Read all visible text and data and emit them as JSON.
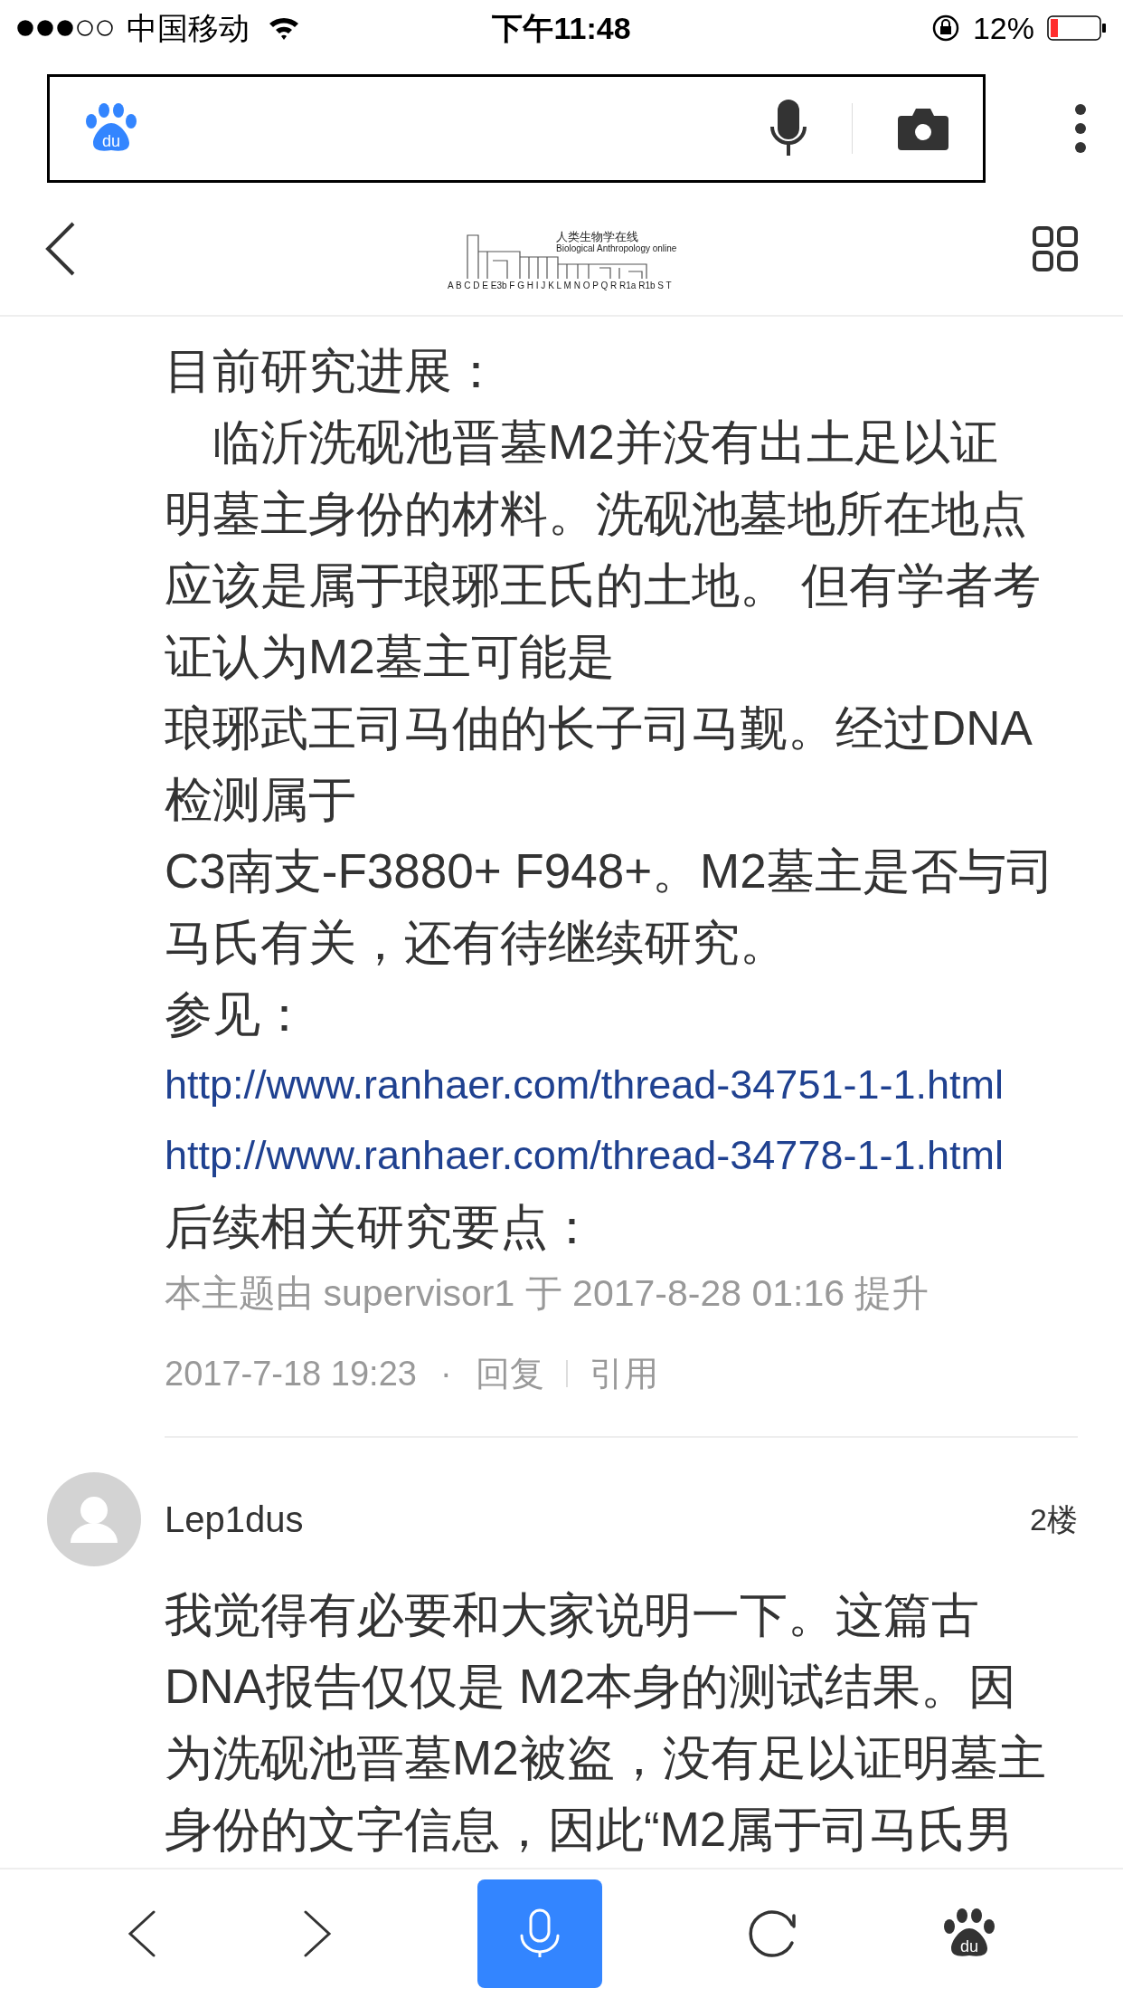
{
  "status_bar": {
    "carrier": "中国移动",
    "time": "下午11:48",
    "battery": "12%"
  },
  "search_bar": {
    "logo_text": "du"
  },
  "site_header": {
    "title": "人类生物学在线",
    "subtitle": "Biological Anthropology online",
    "letters": "A B C D E E3b F G H I J K L M N O P Q R R1a R1b S T"
  },
  "post_1": {
    "lines": [
      {
        "kind": "text",
        "text": "目前研究进展："
      },
      {
        "kind": "text",
        "text": "　临沂洗砚池晋墓M2并没有出土足以证"
      },
      {
        "kind": "text",
        "text": "明墓主身份的材料。洗砚池墓地所在地点"
      },
      {
        "kind": "text",
        "text": "应该是属于琅琊王氏的土地。 但有学者考"
      },
      {
        "kind": "text",
        "text": "证认为M2墓主可能是"
      },
      {
        "kind": "text",
        "text": "琅琊武王司马伷的长子司马觐。经过DNA"
      },
      {
        "kind": "text",
        "text": "检测属于"
      },
      {
        "kind": "text",
        "text": "C3南支-F3880+ F948+。M2墓主是否与司"
      },
      {
        "kind": "text",
        "text": "马氏有关，还有待继续研究。"
      },
      {
        "kind": "text",
        "text": "参见："
      },
      {
        "kind": "link",
        "text": "http://www.ranhaer.com/thread-34751-1-1.html"
      },
      {
        "kind": "link",
        "text": "http://www.ranhaer.com/thread-34778-1-1.html"
      },
      {
        "kind": "text",
        "text": "后续相关研究要点："
      }
    ],
    "edit_note": "本主题由 supervisor1 于 2017-8-28 01:16 提升",
    "date": "2017-7-18 19:23",
    "separator": "·",
    "actions": [
      "回复",
      "引用"
    ]
  },
  "post_2": {
    "author": "Lep1dus",
    "floor": "2楼",
    "lines": [
      "我觉得有必要和大家说明一下。这篇古",
      "DNA报告仅仅是 M2本身的测试结果。因",
      "为洗砚池晋墓M2被盗，没有足以证明墓主",
      "身份的文字信息，因此“M2属于司马氏男"
    ]
  },
  "toolbar": {
    "logo_text": "du"
  }
}
